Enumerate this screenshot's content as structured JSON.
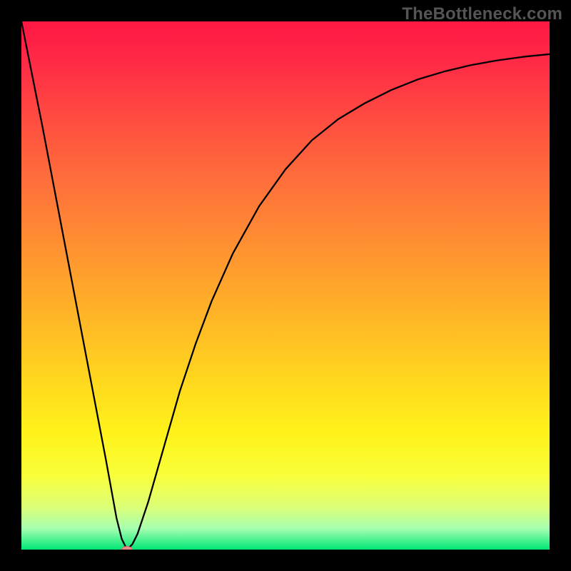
{
  "watermark": "TheBottleneck.com",
  "chart_data": {
    "type": "line",
    "title": "",
    "xlabel": "",
    "ylabel": "",
    "xlim": [
      0,
      100
    ],
    "ylim": [
      0,
      100
    ],
    "grid": false,
    "background_gradient": {
      "orientation": "vertical",
      "stops": [
        {
          "pos": 0.0,
          "color": "#ff1744"
        },
        {
          "pos": 0.08,
          "color": "#ff2b46"
        },
        {
          "pos": 0.18,
          "color": "#ff4b41"
        },
        {
          "pos": 0.3,
          "color": "#ff6e3b"
        },
        {
          "pos": 0.42,
          "color": "#ff8f32"
        },
        {
          "pos": 0.54,
          "color": "#ffb028"
        },
        {
          "pos": 0.66,
          "color": "#ffd21f"
        },
        {
          "pos": 0.78,
          "color": "#fff21a"
        },
        {
          "pos": 0.86,
          "color": "#f8ff3a"
        },
        {
          "pos": 0.92,
          "color": "#dcff78"
        },
        {
          "pos": 0.96,
          "color": "#a6ffb0"
        },
        {
          "pos": 1.0,
          "color": "#00e676"
        }
      ]
    },
    "series": [
      {
        "name": "bottleneck-curve",
        "color": "#000000",
        "width": 2.3,
        "x": [
          0,
          4,
          8,
          12,
          16,
          18,
          19,
          20,
          21,
          22,
          24,
          26,
          28,
          30,
          33,
          36,
          40,
          45,
          50,
          55,
          60,
          65,
          70,
          75,
          80,
          85,
          90,
          95,
          100
        ],
        "y": [
          100,
          80,
          59,
          38,
          17,
          6,
          2,
          0,
          1,
          3,
          9,
          16,
          23,
          30,
          39,
          47,
          56,
          65,
          72,
          77.5,
          81.5,
          84.5,
          87,
          89,
          90.5,
          91.7,
          92.6,
          93.3,
          93.8
        ]
      }
    ],
    "markers": [
      {
        "name": "optimal-point",
        "shape": "ellipse",
        "x": 20,
        "y": 0,
        "rx": 1.0,
        "ry": 0.6,
        "fill": "#e98888",
        "stroke": "#d46a6a"
      }
    ]
  }
}
